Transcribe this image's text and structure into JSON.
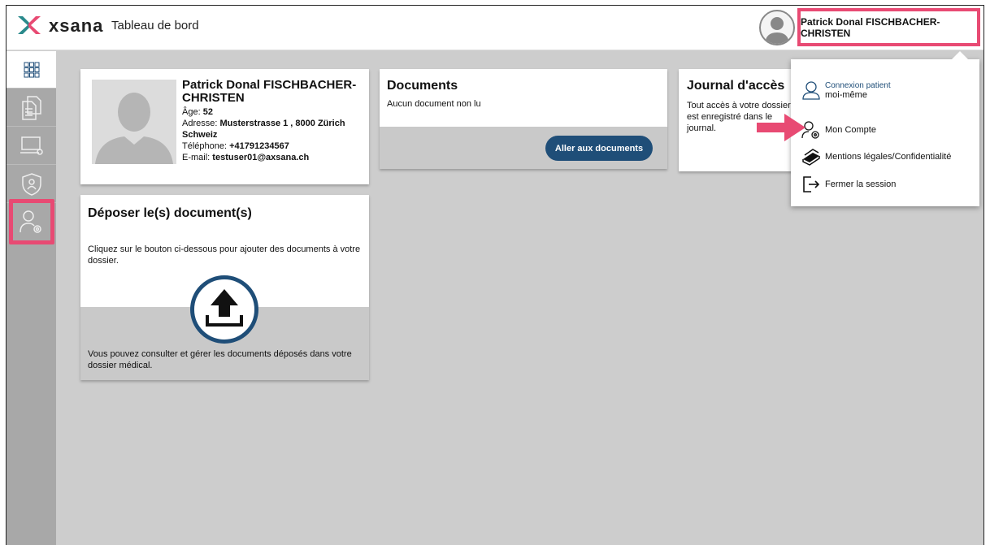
{
  "header": {
    "brand": "xsana",
    "title": "Tableau de bord",
    "user_name": "Patrick Donal FISCHBACHER-CHRISTEN"
  },
  "sidebar": {
    "items": [
      {
        "icon": "grid-icon",
        "active": true
      },
      {
        "icon": "documents-icon",
        "active": false
      },
      {
        "icon": "laptop-icon",
        "active": false
      },
      {
        "icon": "shield-icon",
        "active": false
      },
      {
        "icon": "user-settings-icon",
        "active": false,
        "highlighted": true
      }
    ]
  },
  "profile": {
    "name": "Patrick Donal FISCHBACHER-CHRISTEN",
    "age_label": "Âge:",
    "age_value": "52",
    "address_label": "Adresse:",
    "address_value": "Musterstrasse 1 , 8000 Zürich Schweiz",
    "phone_label": "Téléphone:",
    "phone_value": "+41791234567",
    "email_label": "E-mail:",
    "email_value": "testuser01@axsana.ch"
  },
  "documents": {
    "title": "Documents",
    "status": "Aucun document non lu",
    "button": "Aller aux documents"
  },
  "journal": {
    "title": "Journal d'accès",
    "text": "Tout accès à votre dossier est enregistré dans le journal."
  },
  "upload": {
    "title": "Déposer le(s) document(s)",
    "description": "Cliquez sur le bouton ci-dessous pour ajouter des documents à votre dossier.",
    "footer": "Vous pouvez consulter et gérer les documents déposés dans votre dossier médical."
  },
  "dropdown": {
    "login_label": "Connexion patient",
    "login_value": "moi-même",
    "account": "Mon Compte",
    "legal": "Mentions légales/Confidentialité",
    "logout": "Fermer la session"
  },
  "colors": {
    "accent": "#1f4e78",
    "highlight": "#e84a73",
    "sidebar": "#a8a8a8",
    "background": "#cdcdcd"
  }
}
